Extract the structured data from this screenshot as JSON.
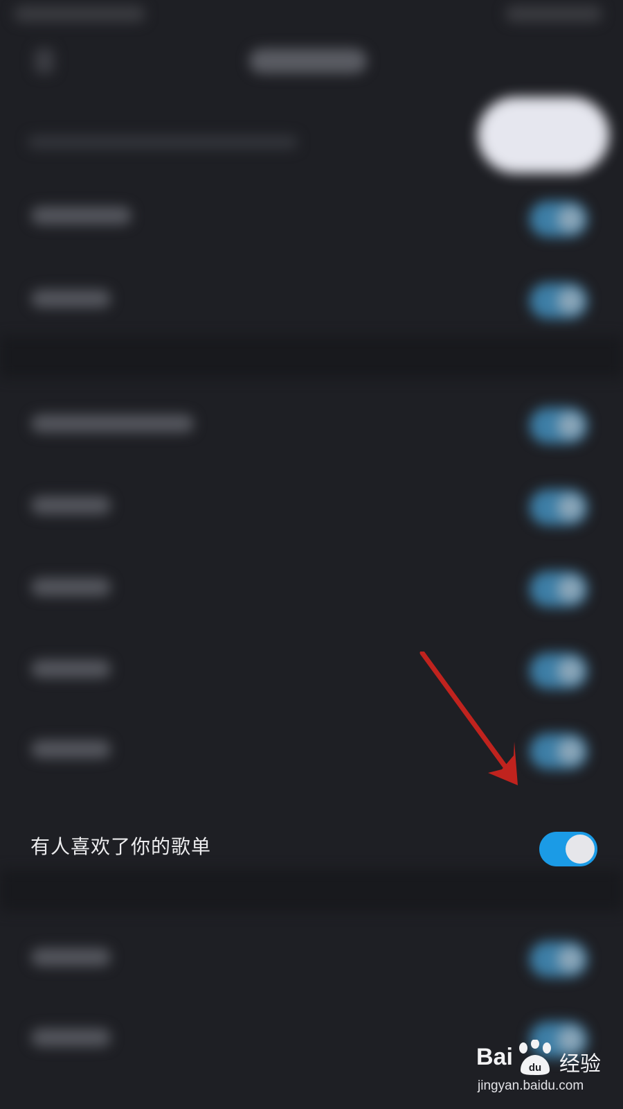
{
  "notification_row": {
    "label": "有人喜欢了你的歌单",
    "toggle_on": true
  },
  "colors": {
    "background": "#1e1f24",
    "toggle_on": "#1b9be6",
    "annotation_arrow": "#c0231e"
  },
  "watermark": {
    "brand": "Bai",
    "product": "经验",
    "url": "jingyan.baidu.com"
  },
  "icons": {
    "toggle": "toggle-switch-icon",
    "annotation": "red-arrow-icon",
    "watermark_paw": "baidu-paw-icon"
  }
}
